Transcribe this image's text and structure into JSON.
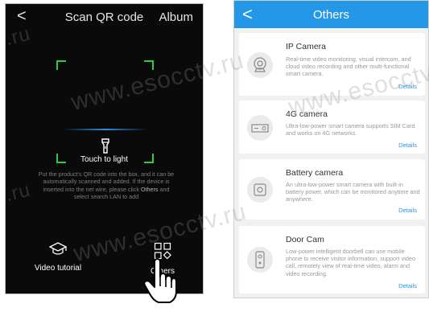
{
  "scan_screen": {
    "back_label": "<",
    "title": "Scan QR code",
    "album_label": "Album",
    "torch_label": "Touch to light",
    "hint_before": "Put the product's QR code into the box, and it can be automatically scanned and added. If the device is inserted into the net wire, please click",
    "hint_others": "Others",
    "hint_after": "and select search LAN to add",
    "video_tutorial_label": "Video tutorial",
    "others_label": "Others"
  },
  "others_screen": {
    "back_label": "<",
    "title": "Others",
    "cards": [
      {
        "title": "IP Camera",
        "description": "Real-time video monitoring, visual intercom, and cloud video recording and other multi-functional smart camera.",
        "details_label": "Details",
        "icon": "ip-camera-icon"
      },
      {
        "title": "4G camera",
        "description": "Ultra-low-power smart camera supports SIM Card and works on 4G networks.",
        "details_label": "Details",
        "icon": "4g-camera-icon"
      },
      {
        "title": "Battery camera",
        "description": "An ultra-low-power smart camera with built-in battery power, which can be monitored anytime and anywhere.",
        "details_label": "Details",
        "icon": "battery-camera-icon"
      },
      {
        "title": "Door Cam",
        "description": "Low-power intelligent doorbell can use mobile phone to receive visitor information, support video call, remotely view of real-time video, alarm and video recording.",
        "details_label": "Details",
        "icon": "doorbell-icon"
      }
    ]
  },
  "watermark": "www.esocctv.ru",
  "watermark_fragment": ".ru",
  "colors": {
    "accent_blue": "#2597e7",
    "scan_frame_green": "#2ecc40",
    "scan_background": "#0a0a0a"
  }
}
